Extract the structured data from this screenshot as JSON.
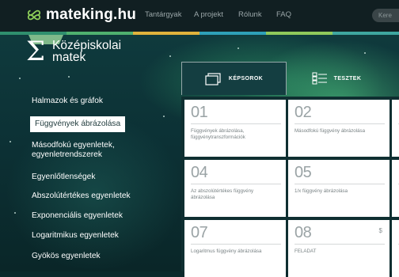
{
  "header": {
    "logo_text": "mateking.hu",
    "nav": [
      {
        "label": "Tantárgyak"
      },
      {
        "label": "A projekt"
      },
      {
        "label": "Rólunk"
      },
      {
        "label": "FAQ"
      }
    ],
    "search_placeholder": "Kere"
  },
  "colors": {
    "topbar": "#111f22",
    "stripe": [
      "#2f8f6e",
      "#4fb06f",
      "#e0b23c",
      "#2ea0b8",
      "#8fc95b",
      "#3fa7a0"
    ],
    "accent_notch": "#7fb98a"
  },
  "sidebar": {
    "title_line1": "Középiskolai",
    "title_line2": "matek",
    "items": [
      {
        "label": "Halmazok és gráfok"
      },
      {
        "label": "Függvények ábrázolása"
      },
      {
        "label": "Másodfokú egyenletek,"
      },
      {
        "label": "egyenletrendszerek"
      },
      {
        "label": "Egyenlőtlenségek"
      },
      {
        "label": "Abszolútértékes egyenletek"
      },
      {
        "label": "Exponenciális egyenletek"
      },
      {
        "label": "Logaritmikus egyenletek"
      },
      {
        "label": "Gyökös egyenletek"
      }
    ],
    "active_index": 1
  },
  "tabs": [
    {
      "label": "KÉPSOROK",
      "icon": "slides-icon"
    },
    {
      "label": "TESZTEK",
      "icon": "list-icon"
    }
  ],
  "cards": [
    {
      "num": "01",
      "desc": "Függvények ábrázolása, függvénytranszformációk",
      "price": ""
    },
    {
      "num": "02",
      "desc": "Másodfokú függvény ábrázolása",
      "price": ""
    },
    {
      "num": "04",
      "desc": "Az abszolútértékes függvény ábrázolása",
      "price": ""
    },
    {
      "num": "05",
      "desc": "1/x függvény ábrázolása",
      "price": ""
    },
    {
      "num": "07",
      "desc": "Logaritmus függvény ábrázolása",
      "price": ""
    },
    {
      "num": "08",
      "desc": "FELADAT",
      "price": "$"
    }
  ]
}
